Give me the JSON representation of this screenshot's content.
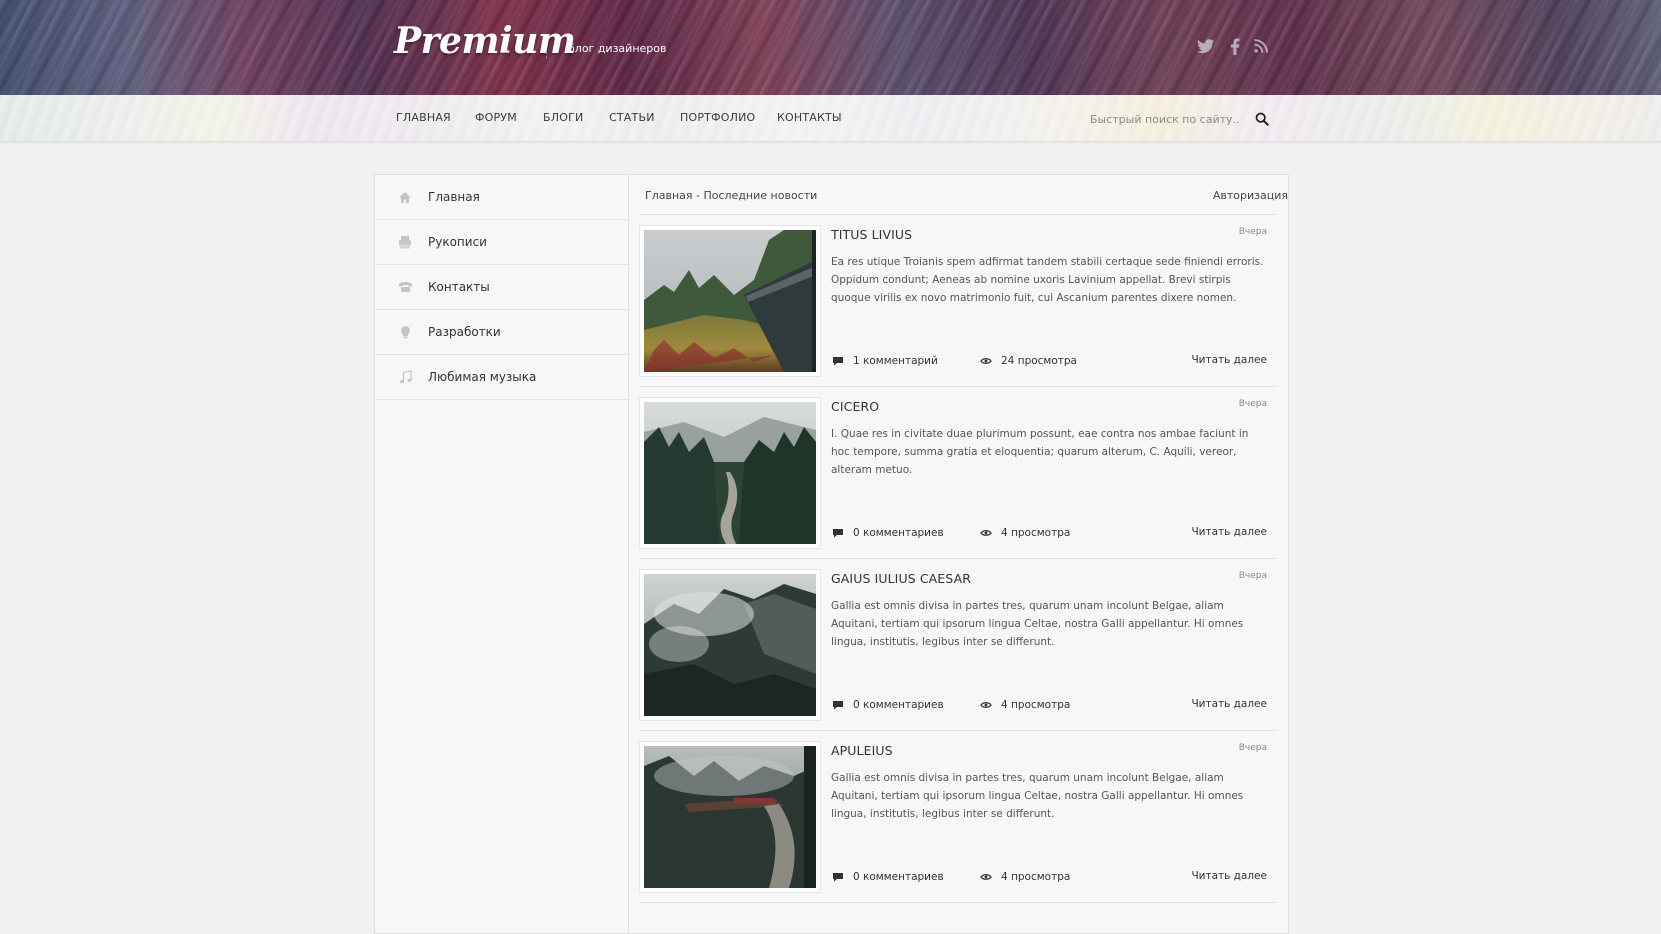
{
  "header": {
    "logo": "Premium",
    "tagline": "блог дизайнеров",
    "social": [
      "twitter-icon",
      "facebook-icon",
      "rss-icon"
    ]
  },
  "nav": {
    "items": [
      "ГЛАВНАЯ",
      "ФОРУМ",
      "БЛОГИ",
      "СТАТЬИ",
      "ПОРТФОЛИО",
      "КОНТАКТЫ"
    ],
    "search_placeholder": "Быстрый поиск по сайту..."
  },
  "sidebar": {
    "items": [
      {
        "label": "Главная",
        "icon": "home-icon"
      },
      {
        "label": "Рукописи",
        "icon": "printer-icon"
      },
      {
        "label": "Контакты",
        "icon": "phone-icon"
      },
      {
        "label": "Разработки",
        "icon": "lightbulb-icon"
      },
      {
        "label": "Любимая музыка",
        "icon": "music-note-icon"
      }
    ]
  },
  "main": {
    "breadcrumb": "Главная - Последние новости",
    "auth": "Авторизация",
    "read_more": "Читать далее",
    "posts": [
      {
        "title": "TITUS LIVIUS",
        "date": "Вчера",
        "text": "Ea res utique Troianis spem adfirmat tandem stabili certaque sede finiendi erroris. Oppidum condunt; Aeneas ab nomine uxoris Lavinium appellat. Brevi stirpis quoque virilis ex novo matrimonio fuit, cui Ascanium parentes dixere nomen.",
        "comments": "1 комментарий",
        "views": "24 просмотра"
      },
      {
        "title": "CICERO",
        "date": "Вчера",
        "text": "I. Quae res in civitate duae plurimum possunt, eae contra nos ambae faciunt in hoc tempore, summa gratia et eloquentia; quarum alterum, C. Aquili, vereor, alteram metuo.",
        "comments": "0 комментариев",
        "views": "4 просмотра"
      },
      {
        "title": "GAIUS IULIUS CAESAR",
        "date": "Вчера",
        "text": "Gallia est omnis divisa in partes tres, quarum unam incolunt Belgae, aliam Aquitani, tertiam qui ipsorum lingua Celtae, nostra Galli appellantur. Hi omnes lingua, institutis, legibus inter se differunt.",
        "comments": "0 комментариев",
        "views": "4 просмотра"
      },
      {
        "title": "APULEIUS",
        "date": "Вчера",
        "text": "Gallia est omnis divisa in partes tres, quarum unam incolunt Belgae, aliam Aquitani, tertiam qui ipsorum lingua Celtae, nostra Galli appellantur. Hi omnes lingua, institutis, legibus inter se differunt.",
        "comments": "0 комментариев",
        "views": "4 просмотра"
      }
    ]
  },
  "colors": {
    "text": "#333333",
    "muted": "#8a8a8a",
    "icon": "#555555"
  }
}
